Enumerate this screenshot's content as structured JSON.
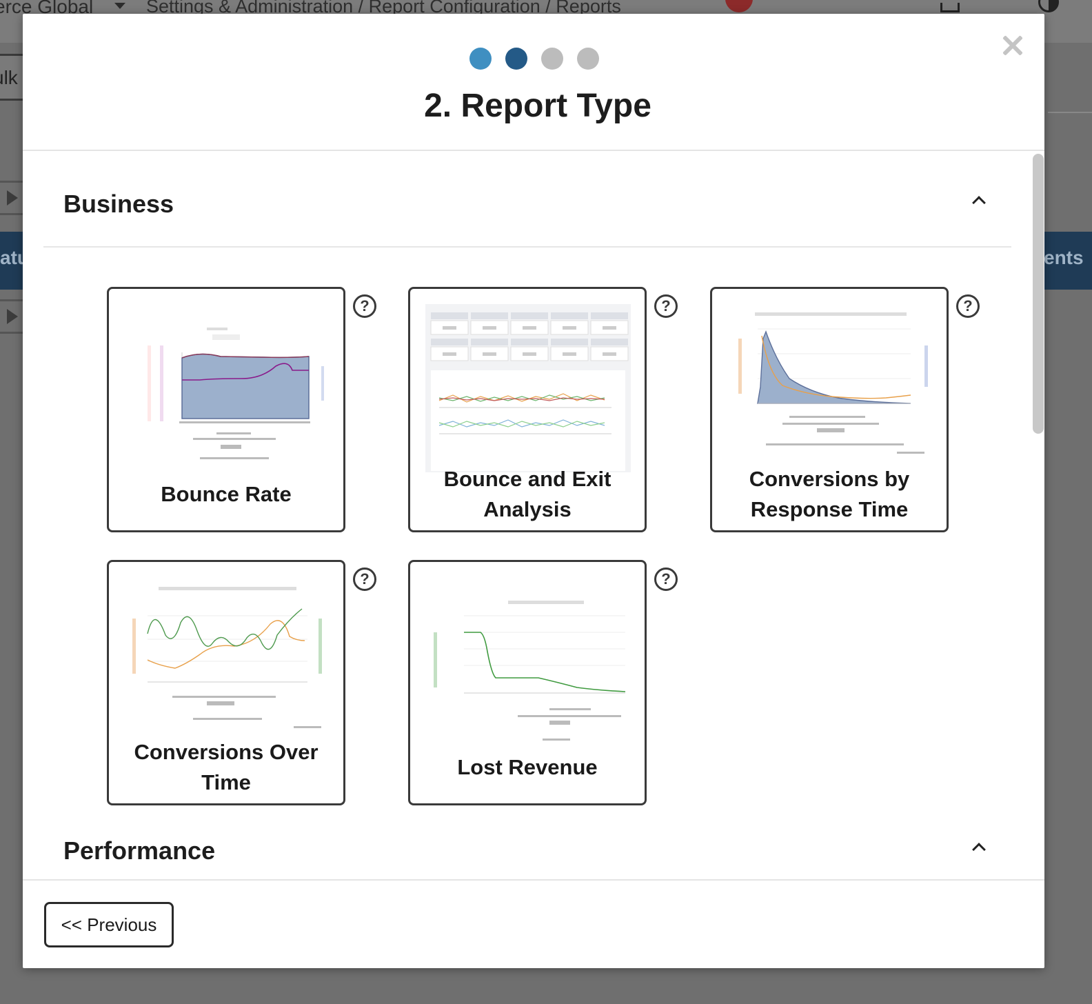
{
  "background": {
    "org_name": "erce Global",
    "breadcrumb": "Settings & Administration / Report Configuration / Reports",
    "bulk_label": "ulk",
    "left_band_label": "atu",
    "right_band_label": "ents"
  },
  "modal": {
    "title": "2. Report Type",
    "steps": [
      {
        "state": "done"
      },
      {
        "state": "active"
      },
      {
        "state": "pending"
      },
      {
        "state": "pending"
      }
    ],
    "colors": {
      "step_done": "#3f8fc1",
      "step_active": "#245a87",
      "step_pending": "#bcbcbc"
    }
  },
  "sections": [
    {
      "title": "Business",
      "expanded": true,
      "cards": [
        {
          "label": "Bounce Rate",
          "icon": "bounce-rate-chart-preview"
        },
        {
          "label": "Bounce and Exit Analysis",
          "icon": "bounce-exit-table-preview"
        },
        {
          "label": "Conversions by Response Time",
          "icon": "conversions-response-chart-preview"
        },
        {
          "label": "Conversions Over Time",
          "icon": "conversions-time-chart-preview"
        },
        {
          "label": "Lost Revenue",
          "icon": "lost-revenue-chart-preview"
        }
      ]
    },
    {
      "title": "Performance",
      "expanded": true,
      "cards": []
    }
  ],
  "help_symbol": "?",
  "footer": {
    "previous_label": "<< Previous"
  }
}
